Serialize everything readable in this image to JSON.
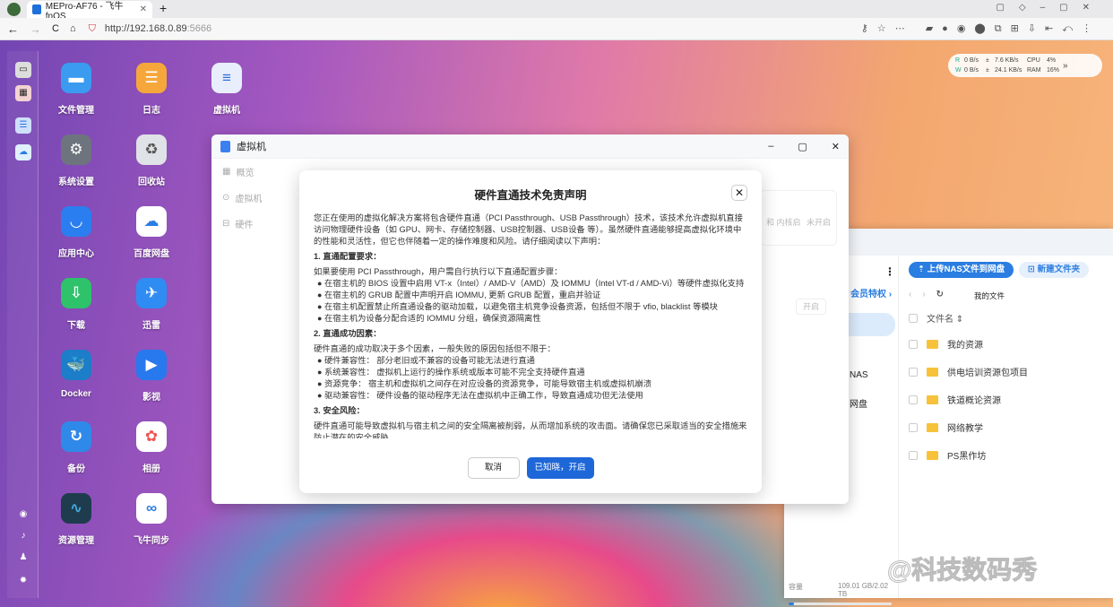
{
  "browser": {
    "tab_title": "MEPro-AF76 - 飞牛 fnOS",
    "url_main": "http://192.168.0.89",
    "url_port": ":5666"
  },
  "netmon": {
    "r": "R",
    "w": "W",
    "r_up": "0  B/s",
    "w_up": "0  B/s",
    "r_down": "7.6 KB/s",
    "w_down": "24.1 KB/s",
    "cpu_label": "CPU",
    "ram_label": "RAM",
    "cpu": "4%",
    "ram": "16%"
  },
  "apps": [
    "文件管理",
    "日志",
    "虚拟机",
    "系统设置",
    "回收站",
    "应用中心",
    "百度网盘",
    "下载",
    "迅雷",
    "Docker",
    "影视",
    "备份",
    "相册",
    "资源管理",
    "飞牛同步"
  ],
  "vm_window": {
    "title": "虚拟机",
    "nav": [
      "概览",
      "虚拟机",
      "硬件"
    ],
    "bg_text1": "和 内核启",
    "bg_status": "未开启",
    "bg_btn": "开启"
  },
  "modal": {
    "title": "硬件直通技术免责声明",
    "intro": "您正在使用的虚拟化解决方案将包含硬件直通（PCI Passthrough、USB Passthrough）技术，该技术允许虚拟机直接访问物理硬件设备（如 GPU、网卡、存储控制器、USB控制器、USB设备 等）。虽然硬件直通能够提高虚拟化环境中的性能和灵活性，但它也伴随着一定的操作难度和风险。请仔细阅读以下声明：",
    "s1": "1. 直通配置要求：",
    "s1_intro": "如果要使用 PCI Passthrough，用户需自行执行以下直通配置步骤：",
    "s1_items": [
      "在宿主机的 BIOS 设置中启用 VT-x（Intel）/ AMD-V（AMD）及 IOMMU（Intel VT-d / AMD-Vi）等硬件虚拟化支持",
      "在宿主机的 GRUB 配置中声明开启 IOMMU, 更新 GRUB 配置，重启并验证",
      "在宿主机配置禁止所直通设备的驱动加载，以避免宿主机竞争设备资源，包括但不限于 vfio, blacklist 等模块",
      "在宿主机为设备分配合适的 IOMMU 分组，确保资源隔离性"
    ],
    "s2": "2. 直通成功因素：",
    "s2_intro": "硬件直通的成功取决于多个因素，一般失败的原因包括但不限于：",
    "s2_items": [
      "硬件兼容性：  部分老旧或不兼容的设备可能无法进行直通",
      "系统兼容性：  虚拟机上运行的操作系统或版本可能不完全支持硬件直通",
      "资源竞争：  宿主机和虚拟机之间存在对应设备的资源竞争，可能导致宿主机或虚拟机崩溃",
      "驱动兼容性：  硬件设备的驱动程序无法在虚拟机中正确工作，导致直通成功但无法使用"
    ],
    "s3": "3. 安全风险：",
    "s3_text": "硬件直通可能导致虚拟机与宿主机之间的安全隔离被削弱，从而增加系统的攻击面。请确保您已采取适当的安全措施来防止潜在的安全威胁。",
    "cancel": "取消",
    "ok": "已知晓，开启"
  },
  "file_manager": {
    "upload": "上传NAS文件到网盘",
    "new_folder": "新建文件夹",
    "vip": "会员特权 ›",
    "breadcrumb": "我的文件",
    "col_name": "文件名 ⇕",
    "side_nas": "NAS",
    "side_pan": "网盘",
    "folders": [
      "我的资源",
      "供电培训资源包项目",
      "铁道概论资源",
      "网络教学",
      "PS黑作坊"
    ],
    "capacity_label": "容量",
    "capacity": "109.01 GB/2.02 TB",
    "capacity_fraction": 0.053
  },
  "watermark": "@科技数码秀"
}
